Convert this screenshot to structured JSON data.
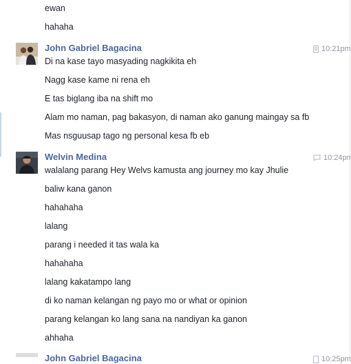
{
  "thread": {
    "top_messages": [
      "ewan",
      "hahaha"
    ],
    "groups": [
      {
        "sender": "John Gabriel Bagacina",
        "time": "10:21pm",
        "icon": "mobile-icon",
        "messages": [
          "Di na kase tayo masyading nagkikita eh",
          "Nagg kase kame ni rena eh",
          "E tas biglang iba na shift mo",
          "Alam mo naman, pag bakasyon, di naman ako ganung maingay sa fb",
          "Mas nsguusap tago ng personal kesa fb eb"
        ]
      },
      {
        "sender": "Welvin Medina",
        "time": "10:24pm",
        "icon": "chat-bubble-icon",
        "messages": [
          "walalang parang Hey Welvs kamusta ang journey mo kay Jhulie",
          "baliw kana ganon",
          "hahahaha",
          "lalang",
          "parang i needed it tas wala ka",
          "hahahaha",
          "lalang kakatampo lang",
          "di ko naman kelangan ng payo mo or what or opinion",
          "parang kelangan ko lang sana na nandiyan ka ganon",
          "ahhaha"
        ]
      },
      {
        "sender": "John Gabriel Bagacina",
        "time": "10:25pm",
        "icon": "mobile-icon",
        "messages": []
      }
    ]
  },
  "colors": {
    "sender_name": "#4b67a1",
    "message_text": "#1d2129",
    "timestamp": "#90949c"
  }
}
